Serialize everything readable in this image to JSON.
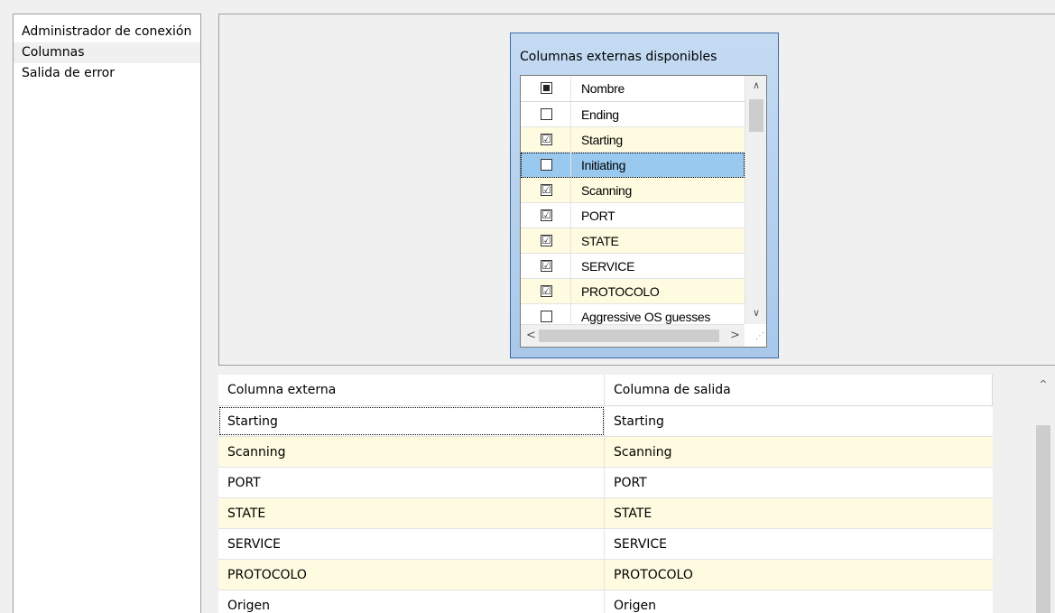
{
  "nav": {
    "items": [
      {
        "label": "Administrador de conexión",
        "active": false
      },
      {
        "label": "Columnas",
        "active": true
      },
      {
        "label": "Salida de error",
        "active": false
      }
    ]
  },
  "popup": {
    "title": "Columnas externas disponibles",
    "header": {
      "label": "Nombre",
      "state": "indeterminate"
    },
    "items": [
      {
        "label": "Ending",
        "checked": false
      },
      {
        "label": "Starting",
        "checked": true
      },
      {
        "label": "Initiating",
        "checked": false,
        "selected": true
      },
      {
        "label": "Scanning",
        "checked": true
      },
      {
        "label": "PORT",
        "checked": true
      },
      {
        "label": "STATE",
        "checked": true
      },
      {
        "label": "SERVICE",
        "checked": true
      },
      {
        "label": "PROTOCOLO",
        "checked": true
      },
      {
        "label": "Aggressive OS guesses",
        "checked": false
      }
    ],
    "check_glyph": "☑",
    "scroll_up": "∧",
    "scroll_down": "∨",
    "scroll_left": "<",
    "scroll_right": ">"
  },
  "grid": {
    "headers": {
      "external": "Columna externa",
      "output": "Columna de salida"
    },
    "rows": [
      {
        "external": "Starting",
        "output": "Starting"
      },
      {
        "external": "Scanning",
        "output": "Scanning"
      },
      {
        "external": "PORT",
        "output": "PORT"
      },
      {
        "external": "STATE",
        "output": "STATE"
      },
      {
        "external": "SERVICE",
        "output": "SERVICE"
      },
      {
        "external": "PROTOCOLO",
        "output": "PROTOCOLO"
      },
      {
        "external": "Origen",
        "output": "Origen"
      }
    ],
    "scroll_up": "^"
  }
}
